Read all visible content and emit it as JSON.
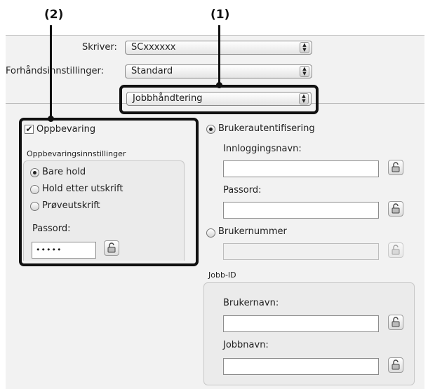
{
  "callouts": {
    "c1": "(1)",
    "c2": "(2)"
  },
  "printer": {
    "label": "Skriver:",
    "value": "SCxxxxxx"
  },
  "presets": {
    "label": "Forhåndsinnstillinger:",
    "value": "Standard"
  },
  "panel_menu": {
    "value": "Jobbhåndtering"
  },
  "retention": {
    "checkbox_label": "Oppbevaring",
    "checked": true,
    "group_title": "Oppbevaringsinnstillinger",
    "options": [
      "Bare hold",
      "Hold etter utskrift",
      "Prøveutskrift"
    ],
    "selected_index": 0,
    "password_label": "Passord:",
    "password_value": "•••••"
  },
  "auth": {
    "user_auth_label": "Brukerautentifisering",
    "login_name_label": "Innloggingsnavn:",
    "password_label": "Passord:",
    "user_number_label": "Brukernummer"
  },
  "job_id": {
    "group_title": "Jobb-ID",
    "user_name_label": "Brukernavn:",
    "job_name_label": "Jobbnavn:"
  },
  "icons": {
    "lock": "lock-icon",
    "updown": "updown-arrows-icon"
  }
}
